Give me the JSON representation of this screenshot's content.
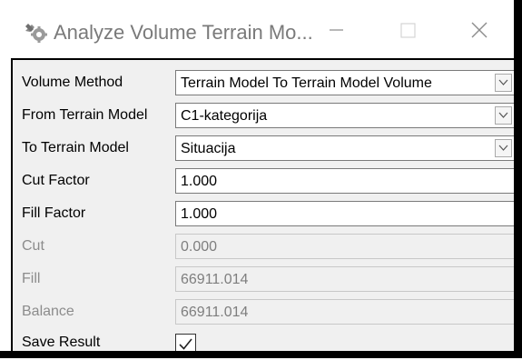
{
  "window": {
    "title": "Analyze Volume Terrain Mo...",
    "title_icon": "gear-wrench-icon",
    "controls": {
      "minimize": "minimize-icon",
      "maximize": "maximize-icon",
      "close": "close-icon"
    }
  },
  "form": {
    "volume_method": {
      "label": "Volume Method",
      "value": "Terrain Model To Terrain Model Volume"
    },
    "from_terrain": {
      "label": "From Terrain Model",
      "value": "C1-kategorija"
    },
    "to_terrain": {
      "label": "To Terrain Model",
      "value": "Situacija"
    },
    "cut_factor": {
      "label": "Cut Factor",
      "value": "1.000"
    },
    "fill_factor": {
      "label": "Fill Factor",
      "value": "1.000"
    },
    "cut": {
      "label": "Cut",
      "value": "0.000"
    },
    "fill": {
      "label": "Fill",
      "value": "66911.014"
    },
    "balance": {
      "label": "Balance",
      "value": "66911.014"
    },
    "save_result": {
      "label": "Save Result",
      "checked": true
    }
  },
  "colors": {
    "disabled_text": "#8c8c8c",
    "panel_bg": "#f0f0f0",
    "title_text": "#7a7a7a"
  }
}
